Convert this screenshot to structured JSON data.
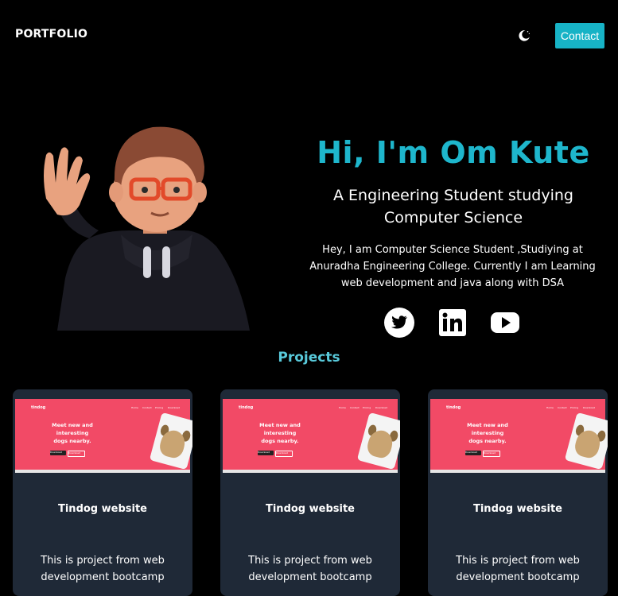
{
  "nav": {
    "brand": "PORTFOLIO",
    "theme_icon": "moon-icon",
    "contact_label": "Contact"
  },
  "hero": {
    "avatar_icon": "waving-3d-avatar",
    "title": "Hi, I'm Om Kute",
    "subtitle": "A Engineering Student studying Computer Science",
    "description": "Hey, I am Computer Science Student ,Studiying at Anuradha Engineering College. Currently I am Learning web development and java along with DSA",
    "social": [
      {
        "icon": "twitter-icon"
      },
      {
        "icon": "linkedin-icon"
      },
      {
        "icon": "youtube-icon"
      }
    ]
  },
  "projects": {
    "title": "Projects",
    "cards": [
      {
        "thumb": {
          "logo": "tindog",
          "nav": [
            "Home",
            "Contact",
            "Pricing",
            "Download"
          ],
          "headline": "Meet new and interesting dogs nearby.",
          "buttons": [
            "Download",
            "Download"
          ]
        },
        "title": "Tindog website",
        "description": "This is project from web development bootcamp"
      },
      {
        "thumb": {
          "logo": "tindog",
          "nav": [
            "Home",
            "Contact",
            "Pricing",
            "Download"
          ],
          "headline": "Meet new and interesting dogs nearby.",
          "buttons": [
            "Download",
            "Download"
          ]
        },
        "title": "Tindog website",
        "description": "This is project from web development bootcamp"
      },
      {
        "thumb": {
          "logo": "tindog",
          "nav": [
            "Home",
            "Contact",
            "Pricing",
            "Download"
          ],
          "headline": "Meet new and interesting dogs nearby.",
          "buttons": [
            "Download",
            "Download"
          ]
        },
        "title": "Tindog website",
        "description": "This is project from web development bootcamp"
      }
    ]
  },
  "colors": {
    "background": "#000000",
    "accent": "#1eb6cc",
    "projects_heading": "#58c9da",
    "card": "#1f2937",
    "thumb": "#f24a66"
  }
}
